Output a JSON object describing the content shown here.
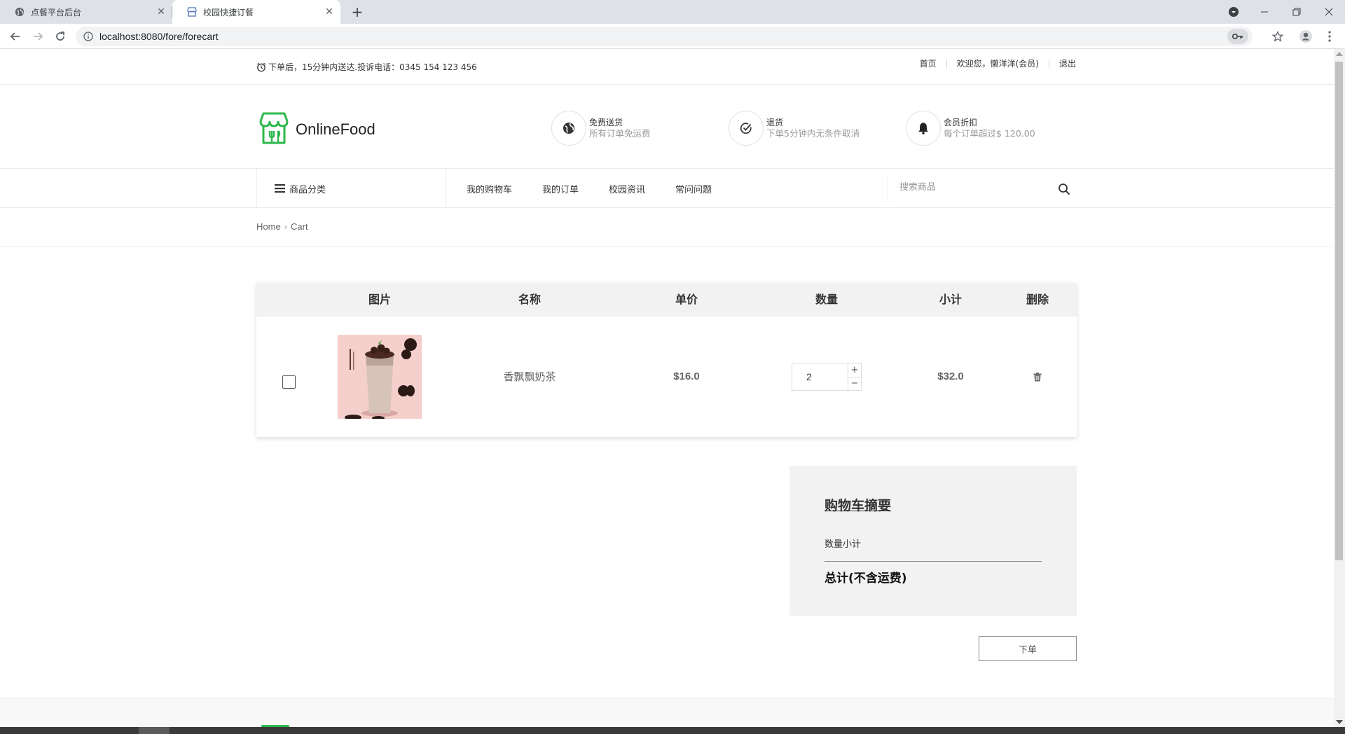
{
  "browser": {
    "tabs": [
      {
        "title": "点餐平台后台",
        "active": false
      },
      {
        "title": "校园快捷订餐",
        "active": true
      }
    ],
    "url": "localhost:8080/fore/forecart"
  },
  "topbar": {
    "notice": "下单后，15分钟内送达.投诉电话：0345 154 123 456",
    "links": [
      "首页",
      "欢迎您，懒洋洋(会员)",
      "退出"
    ]
  },
  "header": {
    "brand": "OnlineFood",
    "brand_color": "#2db84b",
    "features": [
      {
        "icon": "globe-icon",
        "title": "免费送货",
        "subtitle": "所有订单免运费"
      },
      {
        "icon": "check-circle-icon",
        "title": "退货",
        "subtitle": "下单5分钟内无条件取消"
      },
      {
        "icon": "bell-icon",
        "title": "会员折扣",
        "subtitle": "每个订单超过$ 120.00"
      }
    ]
  },
  "nav": {
    "category_label": "商品分类",
    "items": [
      "我的购物车",
      "我的订单",
      "校园资讯",
      "常问问题"
    ],
    "search_placeholder": "搜索商品"
  },
  "breadcrumb": [
    "Home",
    "Cart"
  ],
  "cart": {
    "headers": [
      "图片",
      "名称",
      "单价",
      "数量",
      "小计",
      "删除"
    ],
    "items": [
      {
        "name": "香飘飘奶茶",
        "price": "$16.0",
        "quantity": "2",
        "subtotal": "$32.0",
        "checked": false
      }
    ]
  },
  "summary": {
    "title": "购物车摘要",
    "qty_subtotal_label": "数量小计",
    "total_label": "总计(不含运费)"
  },
  "order_button": "下单"
}
